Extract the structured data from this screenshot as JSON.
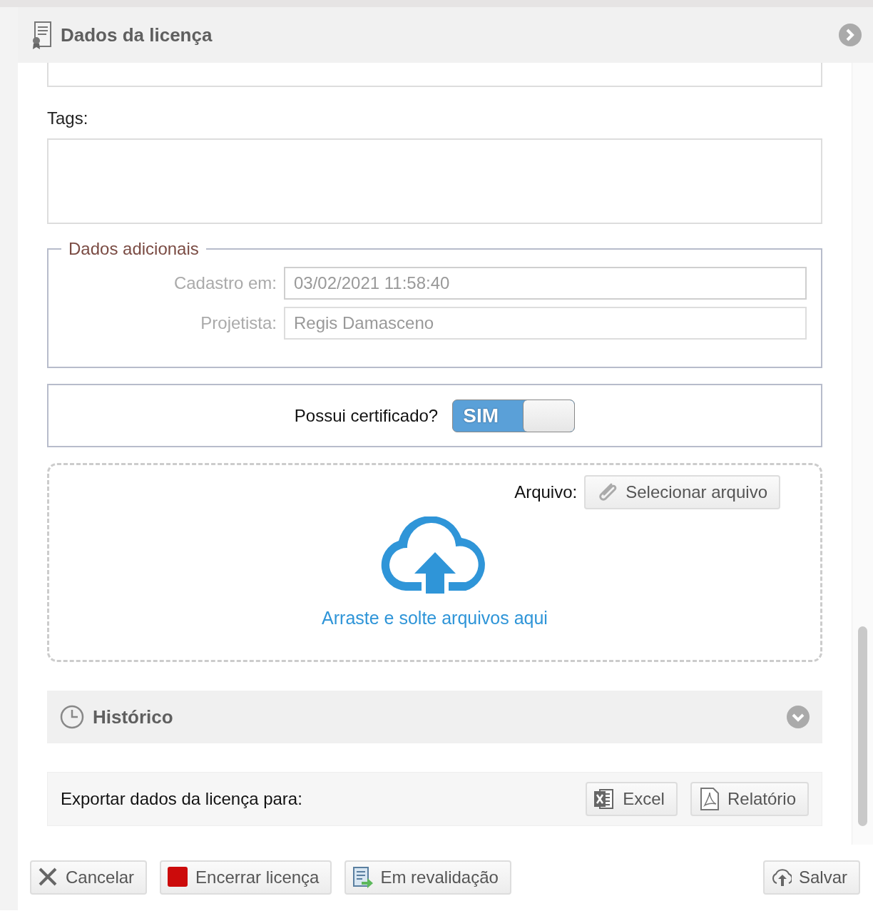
{
  "panel": {
    "title": "Dados da licença"
  },
  "tags": {
    "label": "Tags:"
  },
  "additional": {
    "legend": "Dados adicionais",
    "fields": [
      {
        "label": "Cadastro em:",
        "value": "03/02/2021 11:58:40"
      },
      {
        "label": "Projetista:",
        "value": "Regis Damasceno"
      }
    ]
  },
  "certificate": {
    "label": "Possui certificado?",
    "toggle_text": "SIM",
    "on": true
  },
  "upload": {
    "label": "Arquivo:",
    "button": "Selecionar arquivo",
    "drop_text": "Arraste e solte arquivos aqui"
  },
  "history": {
    "title": "Histórico",
    "expanded": false
  },
  "export": {
    "label": "Exportar dados da licença para:",
    "buttons": [
      {
        "kind": "excel",
        "label": "Excel"
      },
      {
        "kind": "pdf",
        "label": "Relatório"
      }
    ]
  },
  "footer_buttons": [
    {
      "kind": "cancel",
      "label": "Cancelar"
    },
    {
      "kind": "stop",
      "label": "Encerrar licença"
    },
    {
      "kind": "revalidate",
      "label": "Em revalidação"
    },
    {
      "kind": "save",
      "label": "Salvar"
    }
  ]
}
